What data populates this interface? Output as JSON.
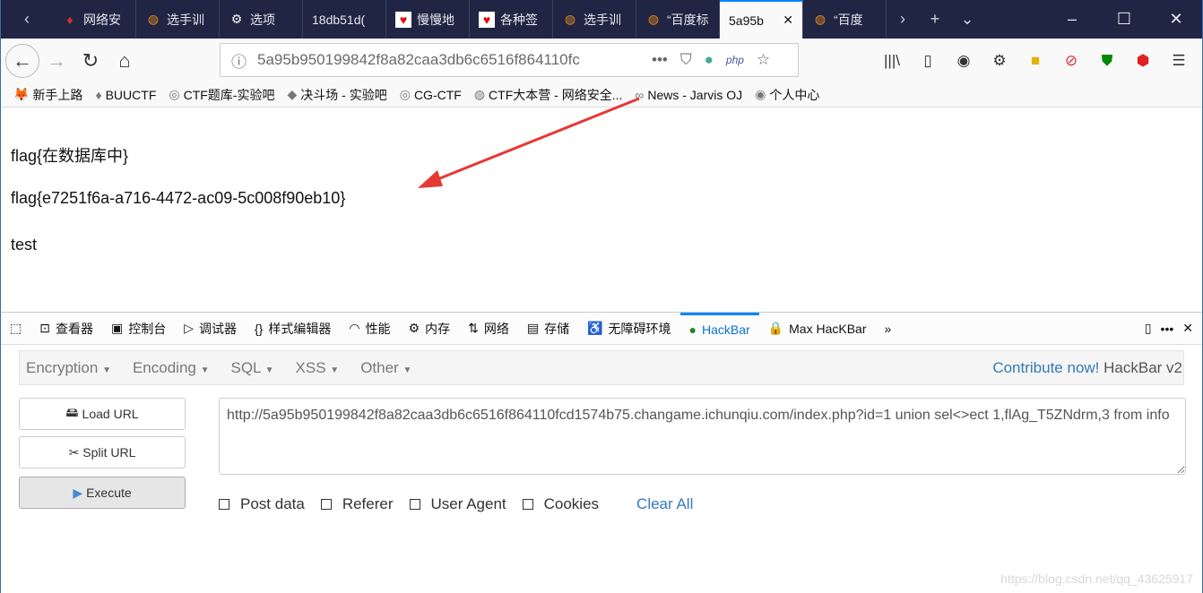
{
  "tabs": [
    {
      "label": "网络安",
      "icon": "buuctf-icon"
    },
    {
      "label": "选手训",
      "icon": "ichunqiu-icon"
    },
    {
      "label": "选项",
      "icon": "gear-icon"
    },
    {
      "label": "18db51d(",
      "icon": ""
    },
    {
      "label": "慢慢地",
      "icon": "heart-icon"
    },
    {
      "label": "各种签",
      "icon": "heart-icon"
    },
    {
      "label": "选手训",
      "icon": "ichunqiu-icon"
    },
    {
      "label": "“百度标",
      "icon": "ichunqiu-icon"
    },
    {
      "label": "5a95b",
      "icon": "",
      "active": true
    },
    {
      "label": "“百度",
      "icon": "ichunqiu-icon"
    }
  ],
  "url": "5a95b950199842f8a82caa3db6c6516f864110fc",
  "bookmarks": [
    "新手上路",
    "BUUCTF",
    "CTF题库-实验吧",
    "决斗场 - 实验吧",
    "CG-CTF",
    "CTF大本营 - 网络安全...",
    "News - Jarvis OJ",
    "个人中心"
  ],
  "page": {
    "line1": "flag{在数据库中}",
    "line2": "flag{e7251f6a-a716-4472-ac09-5c008f90eb10}",
    "line3": "test"
  },
  "devtools": {
    "tabs": [
      "查看器",
      "控制台",
      "调试器",
      "样式编辑器",
      "性能",
      "内存",
      "网络",
      "存储",
      "无障碍环境",
      "HackBar",
      "Max HacKBar"
    ],
    "active": "HackBar"
  },
  "hackbar": {
    "menus": [
      "Encryption",
      "Encoding",
      "SQL",
      "XSS",
      "Other"
    ],
    "contribute": "Contribute now!",
    "version": " HackBar v2",
    "load": "Load URL",
    "split": "Split URL",
    "execute": "Execute",
    "url_value": "http://5a95b950199842f8a82caa3db6c6516f864110fcd1574b75.changame.ichunqiu.com/index.php?id=1 union sel<>ect 1,flAg_T5ZNdrm,3 from info",
    "checks": [
      "Post data",
      "Referer",
      "User Agent",
      "Cookies"
    ],
    "clear": "Clear All"
  },
  "watermark": "https://blog.csdn.net/qq_43625917",
  "colors": {
    "tabbar": "#1f2542",
    "accent": "#0a84ff",
    "link": "#337ab7",
    "arrow": "#e53935"
  }
}
